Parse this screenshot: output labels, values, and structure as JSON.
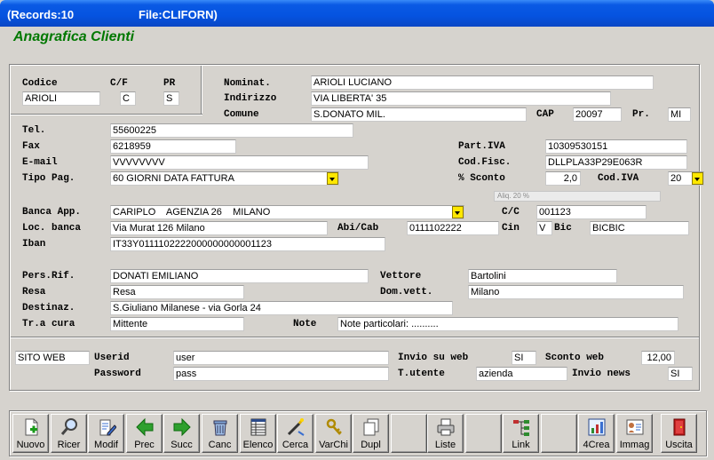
{
  "window": {
    "records": "(Records:10",
    "file": "File:CLIFORN)"
  },
  "header": {
    "title": "Anagrafica Clienti"
  },
  "labels": {
    "codice": "Codice",
    "cf": "C/F",
    "pr": "PR",
    "nominat": "Nominat.",
    "indirizzo": "Indirizzo",
    "comune": "Comune",
    "cap": "CAP",
    "prov": "Pr.",
    "tel": "Tel.",
    "fax": "Fax",
    "email": "E-mail",
    "tipo_pag": "Tipo Pag.",
    "part_iva": "Part.IVA",
    "cod_fisc": "Cod.Fisc.",
    "sconto": "% Sconto",
    "cod_iva": "Cod.IVA",
    "banca_app": "Banca App.",
    "cc": "C/C",
    "loc_banca": "Loc. banca",
    "abicab": "Abi/Cab",
    "cin": "Cin",
    "bic": "Bic",
    "iban": "Iban",
    "pers_rif": "Pers.Rif.",
    "vettore": "Vettore",
    "resa": "Resa",
    "dom_vett": "Dom.vett.",
    "destinaz": "Destinaz.",
    "tra_cura": "Tr.a cura",
    "note": "Note",
    "userid": "Userid",
    "password": "Password",
    "invio_web": "Invio su web",
    "sconto_web": "Sconto web",
    "t_utente": "T.utente",
    "invio_news": "Invio news"
  },
  "values": {
    "codice": "ARIOLI",
    "cf": "C",
    "pr": "S",
    "nominat": "ARIOLI LUCIANO",
    "indirizzo": "VIA LIBERTA' 35",
    "comune": "S.DONATO MIL.",
    "cap": "20097",
    "prov": "MI",
    "tel": "55600225",
    "fax": "6218959",
    "email": "VVVVVVVV",
    "tipo_pag": "60 GIORNI DATA FATTURA",
    "part_iva": "10309530151",
    "cod_fisc": "DLLPLA33P29E063R",
    "sconto": "2,0",
    "cod_iva": "20",
    "aliq_hint": "Aliq. 20 %",
    "banca_app": "CARIPLO    AGENZIA 26    MILANO",
    "cc": "001123",
    "loc_banca": "Via Murat 126  Milano",
    "abicab": "0111102222",
    "cin": "V",
    "bic": "BICBIC",
    "iban": "IT33Y0111102222000000000001123",
    "pers_rif": "DONATI EMILIANO",
    "vettore": "Bartolini",
    "resa": "Resa",
    "dom_vett": "Milano",
    "destinaz": "S.Giuliano Milanese - via Gorla 24",
    "tra_cura": "Mittente",
    "note": "Note particolari: ..........",
    "sito_web": "SITO WEB",
    "userid": "user",
    "password": "pass",
    "invio_web": "SI",
    "sconto_web": "12,00",
    "t_utente": "azienda",
    "invio_news": "SI"
  },
  "toolbar": [
    {
      "label": "Nuovo",
      "icon": "new-document-icon"
    },
    {
      "label": "Ricer",
      "icon": "magnifier-icon"
    },
    {
      "label": "Modif",
      "icon": "edit-document-icon"
    },
    {
      "label": "Prec",
      "icon": "arrow-left-icon"
    },
    {
      "label": "Succ",
      "icon": "arrow-right-icon"
    },
    {
      "label": "Canc",
      "icon": "trash-icon"
    },
    {
      "label": "Elenco",
      "icon": "list-icon"
    },
    {
      "label": "Cerca",
      "icon": "search-wand-icon"
    },
    {
      "label": "VarChi",
      "icon": "keys-icon"
    },
    {
      "label": "Dupl",
      "icon": "duplicate-icon"
    },
    {
      "label": "Liste",
      "icon": "printer-icon"
    },
    {
      "label": "Link",
      "icon": "link-tree-icon"
    },
    {
      "label": "4Crea",
      "icon": "create-chart-icon"
    },
    {
      "label": "Immag",
      "icon": "image-card-icon"
    },
    {
      "label": "Uscita",
      "icon": "exit-door-icon"
    }
  ],
  "colors": {
    "title_bar": "#0553e0",
    "header_title": "#007800",
    "dropdown_button": "#ffe800"
  }
}
